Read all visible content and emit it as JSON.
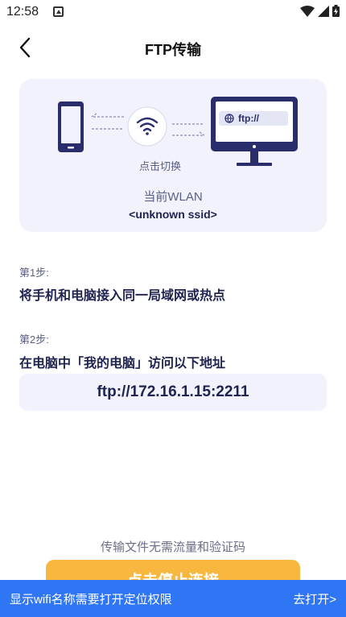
{
  "status_bar": {
    "time": "12:58",
    "icons": [
      "notification-icon",
      "wifi-icon",
      "cell-signal-icon",
      "battery-charging-icon"
    ]
  },
  "nav": {
    "title": "FTP传输",
    "back_icon": "chevron-left-icon"
  },
  "hero": {
    "monitor_url": "ftp://",
    "switch_label": "点击切换",
    "wlan_label": "当前WLAN",
    "ssid": "<unknown ssid>"
  },
  "steps": [
    {
      "caption": "第1步:",
      "text": "将手机和电脑接入同一局域网或热点"
    },
    {
      "caption": "第2步:",
      "text": "在电脑中「我的电脑」访问以下地址"
    }
  ],
  "address": "ftp://172.16.1.15:2211",
  "footer": {
    "note": "传输文件无需流量和验证码",
    "stop_button": "点击停止连接"
  },
  "permission_bar": {
    "message": "显示wifi名称需要打开定位权限",
    "action": "去打开>"
  },
  "colors": {
    "primary_text": "#1f2350",
    "card_bg": "#f1f2fb",
    "accent_orange": "#f8b73e",
    "banner_blue": "#2f76f5"
  }
}
